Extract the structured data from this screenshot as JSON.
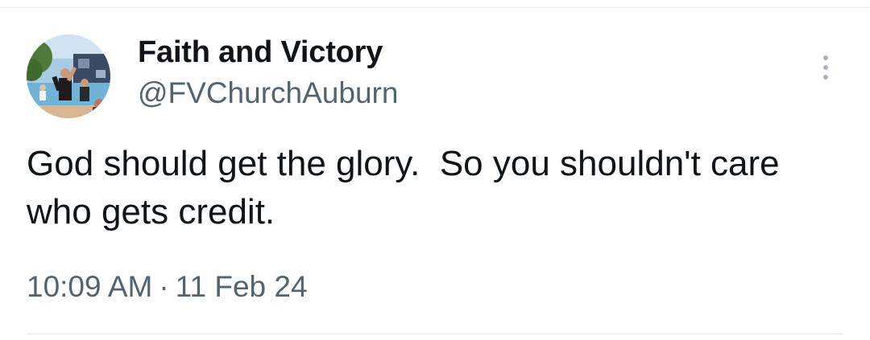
{
  "author": {
    "display_name": "Faith and Victory",
    "handle": "@FVChurchAuburn",
    "avatar_icon": "profile-photo"
  },
  "tweet": {
    "text": "God should get the glory.  So you shouldn't care who gets credit.",
    "time": "10:09 AM",
    "separator": "·",
    "date": "11 Feb 24"
  },
  "menu": {
    "icon": "more-vertical-icon"
  },
  "colors": {
    "text_primary": "#0f1419",
    "text_secondary": "#536471",
    "divider": "#e6e9eb",
    "menu_dots": "#a9b4bd"
  }
}
